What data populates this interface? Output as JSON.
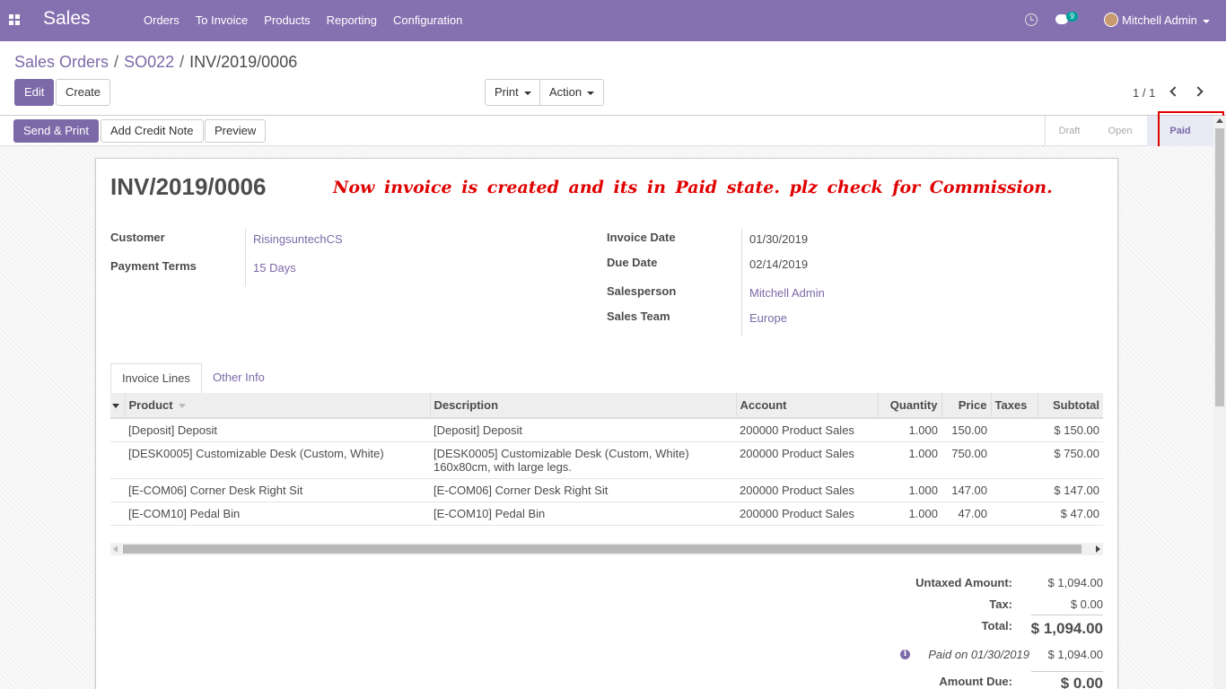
{
  "navbar": {
    "app_name": "Sales",
    "menu": [
      "Orders",
      "To Invoice",
      "Products",
      "Reporting",
      "Configuration"
    ],
    "chat_count": "9",
    "user_name": "Mitchell Admin",
    "color": "#8571b0"
  },
  "breadcrumb": {
    "items": [
      "Sales Orders",
      "SO022"
    ],
    "current": "INV/2019/0006",
    "separator": "/"
  },
  "buttons": {
    "edit": "Edit",
    "create": "Create",
    "print": "Print",
    "action": "Action",
    "send_print": "Send & Print",
    "add_credit_note": "Add Credit Note",
    "preview": "Preview"
  },
  "pager": {
    "value": "1 / 1"
  },
  "statusbar": {
    "steps": [
      "Draft",
      "Open",
      "Paid"
    ],
    "current": "Paid"
  },
  "invoice": {
    "number": "INV/2019/0006",
    "annotation": "Now invoice is created and its in Paid state. plz check for Commission.",
    "fields_left": [
      {
        "label": "Customer",
        "value": "RisingsuntechCS"
      },
      {
        "label": "Payment Terms",
        "value": "15 Days"
      }
    ],
    "fields_right": [
      {
        "label": "Invoice Date",
        "value": "01/30/2019"
      },
      {
        "label": "Due Date",
        "value": "02/14/2019"
      },
      {
        "label": "Salesperson",
        "value": "Mitchell Admin"
      },
      {
        "label": "Sales Team",
        "value": "Europe"
      }
    ]
  },
  "tabs": [
    "Invoice Lines",
    "Other Info"
  ],
  "lines": {
    "columns": [
      "Product",
      "Description",
      "Account",
      "Quantity",
      "Price",
      "Taxes",
      "Subtotal"
    ],
    "rows": [
      {
        "product": "[Deposit] Deposit",
        "description": "[Deposit] Deposit",
        "description2": "",
        "account": "200000 Product Sales",
        "quantity": "1.000",
        "price": "150.00",
        "taxes": "",
        "subtotal": "$ 150.00"
      },
      {
        "product": "[DESK0005] Customizable Desk (Custom, White)",
        "description": "[DESK0005] Customizable Desk (Custom, White)",
        "description2": "160x80cm, with large legs.",
        "account": "200000 Product Sales",
        "quantity": "1.000",
        "price": "750.00",
        "taxes": "",
        "subtotal": "$ 750.00"
      },
      {
        "product": "[E-COM06] Corner Desk Right Sit",
        "description": "[E-COM06] Corner Desk Right Sit",
        "description2": "",
        "account": "200000 Product Sales",
        "quantity": "1.000",
        "price": "147.00",
        "taxes": "",
        "subtotal": "$ 147.00"
      },
      {
        "product": "[E-COM10] Pedal Bin",
        "description": "[E-COM10] Pedal Bin",
        "description2": "",
        "account": "200000 Product Sales",
        "quantity": "1.000",
        "price": "47.00",
        "taxes": "",
        "subtotal": "$ 47.00"
      }
    ]
  },
  "totals": {
    "untaxed_label": "Untaxed Amount:",
    "untaxed": "$ 1,094.00",
    "tax_label": "Tax:",
    "tax": "$ 0.00",
    "total_label": "Total:",
    "total": "$ 1,094.00",
    "paid_on": "Paid on 01/30/2019",
    "paid_amount": "$ 1,094.00",
    "amount_due_label": "Amount Due:",
    "amount_due": "$ 0.00"
  }
}
